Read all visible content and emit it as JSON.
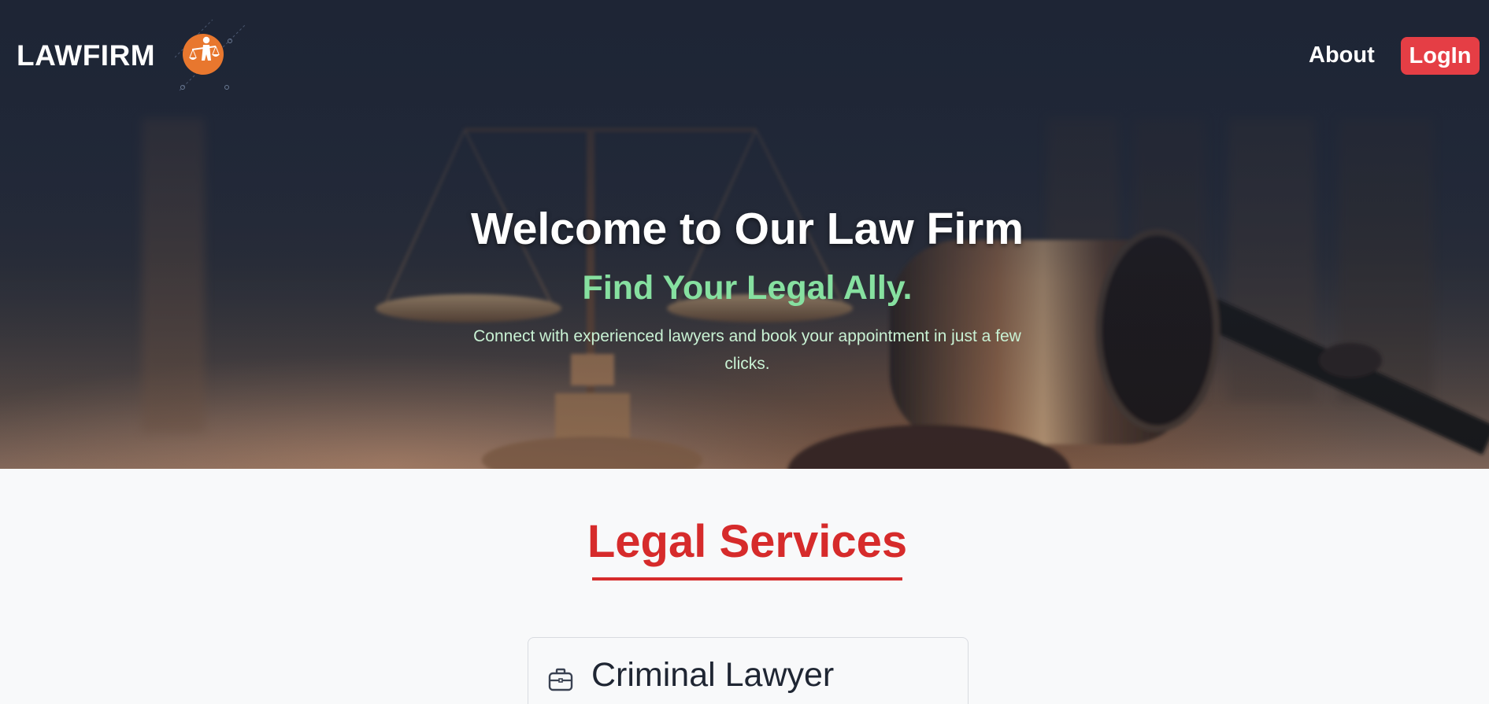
{
  "nav": {
    "brand": "LAWFIRM",
    "logo_icon": "scales-of-justice-icon",
    "about_label": "About",
    "login_label": "LogIn"
  },
  "hero": {
    "title": "Welcome to Our Law Firm",
    "subtitle": "Find Your Legal Ally.",
    "description": "Connect with experienced lawyers and book your appointment in just a few clicks."
  },
  "services": {
    "title": "Legal Services",
    "cards": [
      {
        "icon": "briefcase-icon",
        "title": "Criminal Lawyer"
      }
    ]
  },
  "colors": {
    "nav_bg": "#1e2535",
    "login_bg": "#e53e45",
    "logo_orange": "#e8772e",
    "subtitle_green": "#86e0a0",
    "services_red": "#d62b2b",
    "page_bg": "#f8f9fa"
  }
}
